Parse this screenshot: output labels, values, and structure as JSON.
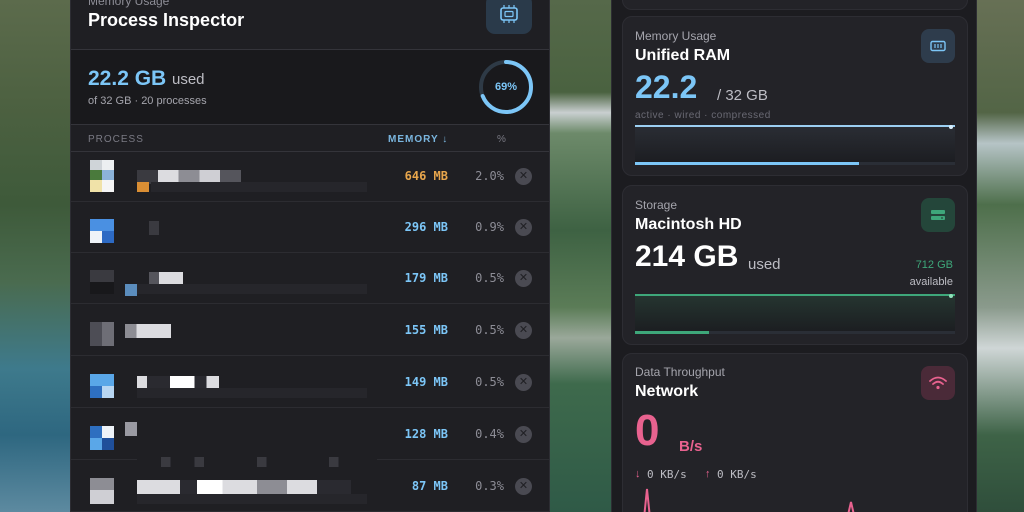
{
  "process_panel": {
    "subtitle": "Memory Usage",
    "title": "Process Inspector",
    "chip_icon": "chip-icon",
    "summary": {
      "used_value": "22.2 GB",
      "used_label": "used",
      "detail": "of 32 GB · 20 processes",
      "ring_percent": 0.69,
      "ring_label": "69%",
      "ring_color": "#7cc6f7"
    },
    "columns": {
      "process": "PROCESS",
      "memory": "MEMORY ↓",
      "percent": "%"
    },
    "rows": [
      {
        "memory": "646 MB",
        "percent": "2.0%",
        "memory_color": "#e8a64c"
      },
      {
        "memory": "296 MB",
        "percent": "0.9%",
        "memory_color": "#7cc6f7"
      },
      {
        "memory": "179 MB",
        "percent": "0.5%",
        "memory_color": "#7cc6f7"
      },
      {
        "memory": "155 MB",
        "percent": "0.5%",
        "memory_color": "#7cc6f7"
      },
      {
        "memory": "149 MB",
        "percent": "0.5%",
        "memory_color": "#7cc6f7"
      },
      {
        "memory": "128 MB",
        "percent": "0.4%",
        "memory_color": "#7cc6f7"
      },
      {
        "memory": "87 MB",
        "percent": "0.3%",
        "memory_color": "#7cc6f7"
      }
    ],
    "kill_glyph": "✕"
  },
  "dashboard": {
    "memory_card": {
      "subtitle": "Memory Usage",
      "title": "Unified RAM",
      "value": "22.2",
      "total": "/ 32 GB",
      "legend": "active · wired · compressed",
      "accent": "#7cc6f7",
      "fill_fraction": 0.7
    },
    "storage_card": {
      "subtitle": "Storage",
      "title": "Macintosh HD",
      "value": "214 GB",
      "unit": "used",
      "available_value": "712 GB",
      "available_label": "available",
      "accent": "#3ea77a",
      "fill_fraction": 0.23
    },
    "network_card": {
      "subtitle": "Data Throughput",
      "title": "Network",
      "value": "0",
      "unit": "B/s",
      "down_icon": "download-arrow-icon",
      "down_rate": "0 KB/s",
      "up_icon": "upload-arrow-icon",
      "up_rate": "0 KB/s",
      "accent": "#e8628f"
    }
  }
}
